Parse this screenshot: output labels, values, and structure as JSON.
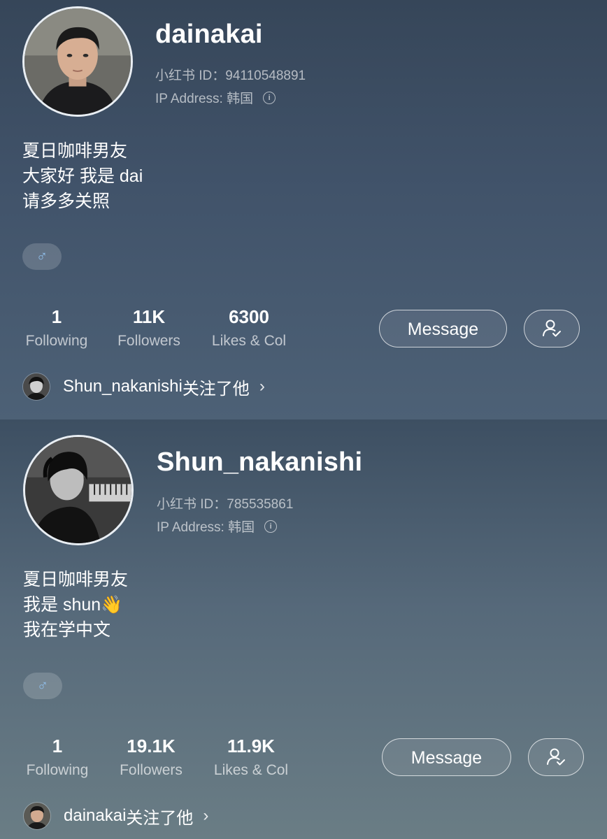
{
  "profiles": [
    {
      "username": "dainakai",
      "id_label": "小红书 ID：",
      "id_value": "94110548891",
      "ip_label": "IP Address: ",
      "ip_value": "韩国",
      "bio": [
        "夏日咖啡男友",
        "大家好 我是 dai",
        "请多多关照"
      ],
      "gender_symbol": "♂",
      "stats": {
        "following": {
          "value": "1",
          "label": "Following"
        },
        "followers": {
          "value": "11K",
          "label": "Followers"
        },
        "likes": {
          "value": "6300",
          "label": "Likes & Col"
        }
      },
      "message_label": "Message",
      "follow_icon": "person-check-icon",
      "mutual": {
        "name": "Shun_nakanishi",
        "text": "关注了他",
        "chevron": "›"
      }
    },
    {
      "username": "Shun_nakanishi",
      "id_label": "小红书 ID：",
      "id_value": "785535861",
      "ip_label": "IP Address: ",
      "ip_value": "韩国",
      "bio": [
        "夏日咖啡男友",
        "我是 shun👋",
        "我在学中文"
      ],
      "gender_symbol": "♂",
      "stats": {
        "following": {
          "value": "1",
          "label": "Following"
        },
        "followers": {
          "value": "19.1K",
          "label": "Followers"
        },
        "likes": {
          "value": "11.9K",
          "label": "Likes & Col"
        }
      },
      "message_label": "Message",
      "follow_icon": "person-check-icon",
      "mutual": {
        "name": "dainakai",
        "text": "关注了他",
        "chevron": "›"
      }
    }
  ],
  "colors": {
    "gender_male": "#8fbde8",
    "panel1_bg": "#41536a",
    "panel2_bg": "#5f7179"
  }
}
